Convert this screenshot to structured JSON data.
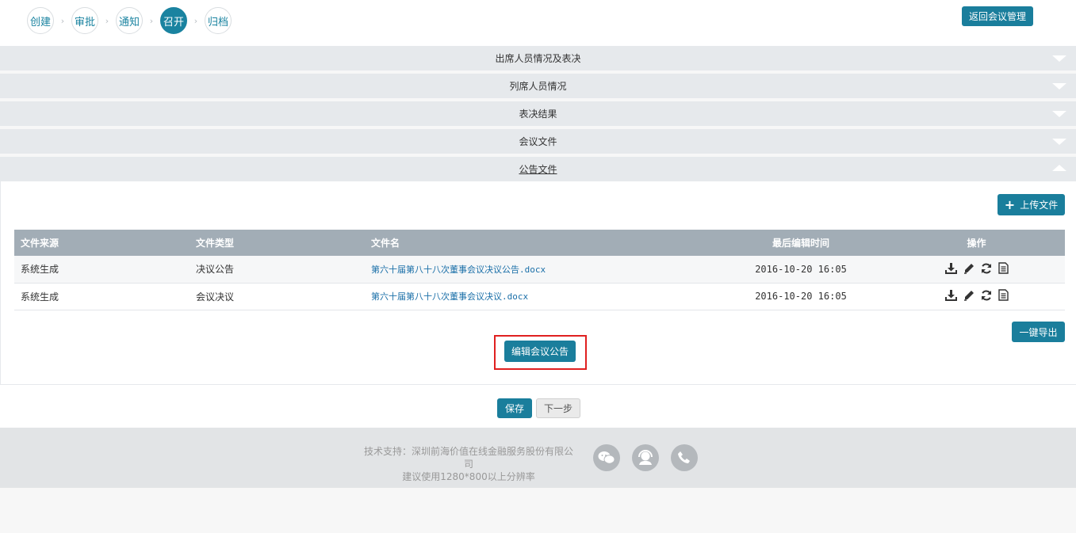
{
  "steps": [
    {
      "label": "创建",
      "active": false
    },
    {
      "label": "审批",
      "active": false
    },
    {
      "label": "通知",
      "active": false
    },
    {
      "label": "召开",
      "active": true
    },
    {
      "label": "归档",
      "active": false
    }
  ],
  "step_separator": "›",
  "header": {
    "back_button": "返回会议管理"
  },
  "accordion": [
    {
      "title": "出席人员情况及表决",
      "expanded": false
    },
    {
      "title": "列席人员情况",
      "expanded": false
    },
    {
      "title": "表决结果",
      "expanded": false
    },
    {
      "title": "会议文件",
      "expanded": false
    },
    {
      "title": "公告文件",
      "expanded": true
    }
  ],
  "panel": {
    "upload_button": "上传文件",
    "upload_icon": "+",
    "table": {
      "headers": [
        "文件来源",
        "文件类型",
        "文件名",
        "最后编辑时间",
        "操作"
      ],
      "rows": [
        {
          "source": "系统生成",
          "type": "决议公告",
          "filename": "第六十届第八十八次董事会议决议公告.docx",
          "time": "2016-10-20 16:05"
        },
        {
          "source": "系统生成",
          "type": "会议决议",
          "filename": "第六十届第八十八次董事会议决议.docx",
          "time": "2016-10-20 16:05"
        }
      ],
      "row_actions": [
        "download-icon",
        "edit-icon",
        "refresh-icon",
        "document-icon"
      ]
    },
    "export_button": "一键导出",
    "edit_announcement_button": "编辑会议公告"
  },
  "actions": {
    "save": "保存",
    "next": "下一步"
  },
  "footer": {
    "line1": "技术支持：深圳前海价值在线金融服务股份有限公司",
    "line2": "建议使用1280*800以上分辨率",
    "icons": [
      "wechat-icon",
      "support-icon",
      "phone-icon"
    ]
  },
  "colors": {
    "primary": "#1a7e9c",
    "highlight": "#e02020",
    "link": "#1a6fa8"
  }
}
